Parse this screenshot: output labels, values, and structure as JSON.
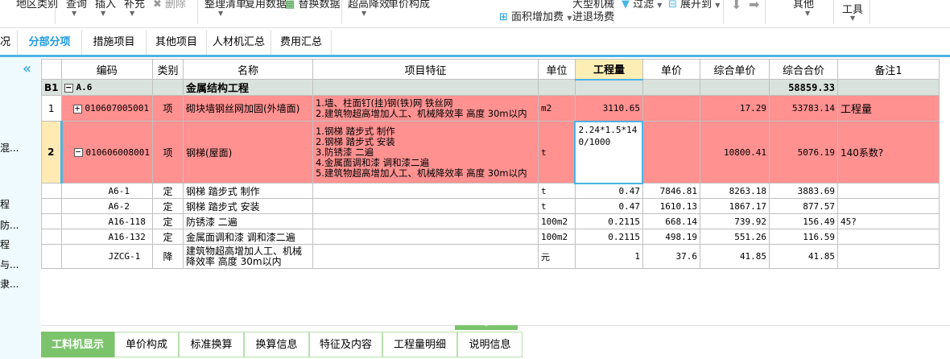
{
  "toolbar": {
    "items": [
      "地区类别",
      "查询",
      "插入",
      "补充",
      "删除",
      "整理清单",
      "复用数据",
      "替换数据",
      "超高降效",
      "单价构成",
      "面积增加费",
      "大型机械",
      "进退场费",
      "过滤",
      "展开到",
      "其他",
      "工具"
    ]
  },
  "tabs": [
    "况",
    "分部分项",
    "措施项目",
    "其他项目",
    "人材机汇总",
    "费用汇总"
  ],
  "sidebar": {
    "items": [
      "混...",
      "程",
      "防...",
      "程",
      "与...",
      "隶..."
    ]
  },
  "table": {
    "headers": [
      "",
      "编码",
      "类别",
      "名称",
      "项目特征",
      "单位",
      "工程量",
      "单价",
      "综合单价",
      "综合合价",
      "备注1"
    ],
    "section": {
      "num": "B1",
      "code": "A.6",
      "name": "金属结构工程",
      "total": "58859.33"
    },
    "rows": [
      {
        "num": "1",
        "code": "010607005001",
        "type": "项",
        "name": "砌块墙钢丝网加固(外墙面)",
        "feature": "1.墙、柱面钉(挂)钢(铁)网 铁丝网\n2.建筑物超高增加人工、机械降效率 高度 30m以内",
        "unit": "m2",
        "qty": "3110.65",
        "price": "",
        "uprice": "17.29",
        "total": "53783.14",
        "note": "工程量"
      },
      {
        "num": "2",
        "code": "010606008001",
        "type": "项",
        "name": "钢梯(屋面)",
        "feature": "1.钢梯 踏步式 制作\n2.钢梯 踏步式 安装\n3.防锈漆 二遍\n4.金属面调和漆 调和漆二遍\n5.建筑物超高增加人工、机械降效率 高度 30m以内",
        "unit": "t",
        "qty": "2.24*1.5*140/1000",
        "price": "",
        "uprice": "10800.41",
        "total": "5076.19",
        "note": "140系数?"
      }
    ],
    "subrows": [
      {
        "code": "A6-1",
        "type": "定",
        "name": "钢梯 踏步式 制作",
        "unit": "t",
        "qty": "0.47",
        "price": "7846.81",
        "uprice": "8263.18",
        "total": "3883.69",
        "note": ""
      },
      {
        "code": "A6-2",
        "type": "定",
        "name": "钢梯 踏步式 安装",
        "unit": "t",
        "qty": "0.47",
        "price": "1610.13",
        "uprice": "1867.17",
        "total": "877.57",
        "note": ""
      },
      {
        "code": "A16-118",
        "type": "定",
        "name": "防锈漆 二遍",
        "unit": "100m2",
        "qty": "0.2115",
        "price": "668.14",
        "uprice": "739.92",
        "total": "156.49",
        "note": "45?"
      },
      {
        "code": "A16-132",
        "type": "定",
        "name": "金属面调和漆 调和漆二遍",
        "unit": "100m2",
        "qty": "0.2115",
        "price": "498.19",
        "uprice": "551.26",
        "total": "116.59",
        "note": ""
      },
      {
        "code": "JZCG-1",
        "type": "降",
        "name": "建筑物超高增加人工、机械降效率 高度 30m以内",
        "unit": "元",
        "qty": "1",
        "price": "37.6",
        "uprice": "41.85",
        "total": "41.85",
        "note": ""
      }
    ]
  },
  "bottom_tabs": [
    "工料机显示",
    "单价构成",
    "标准换算",
    "换算信息",
    "特征及内容",
    "工程量明细",
    "说明信息"
  ]
}
